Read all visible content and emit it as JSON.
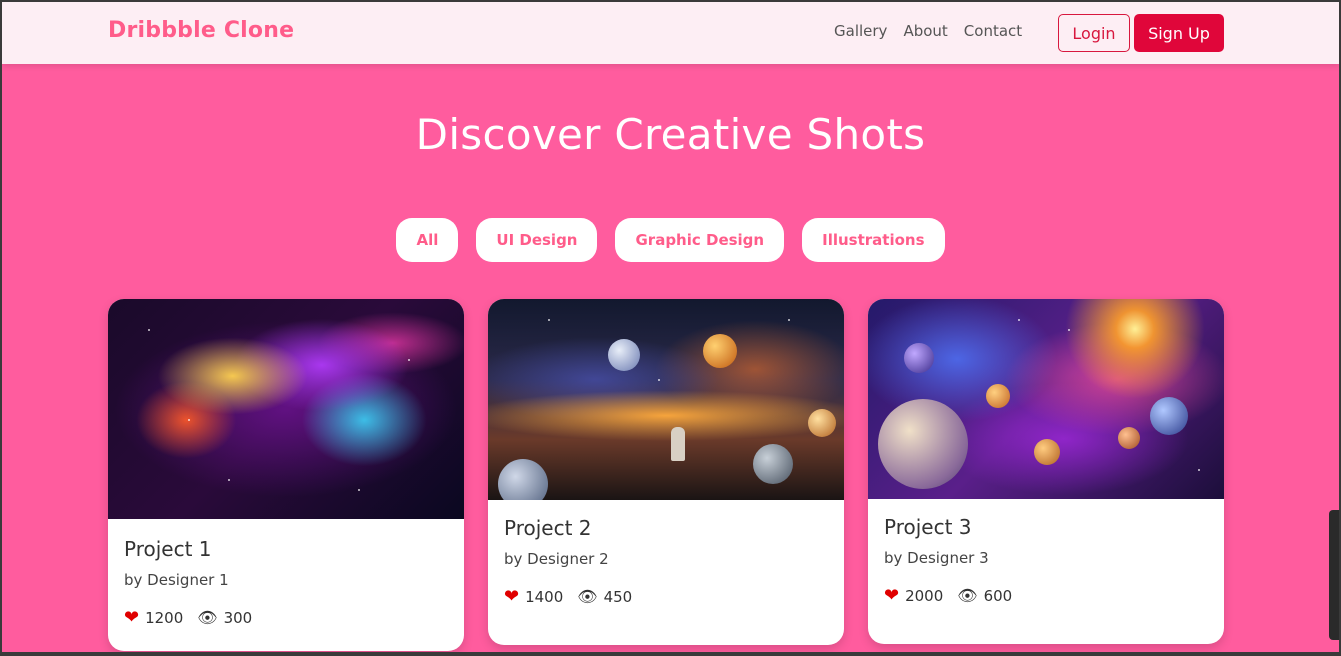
{
  "navbar": {
    "brand": "Dribbble Clone",
    "links": [
      "Gallery",
      "About",
      "Contact"
    ],
    "login_label": "Login",
    "signup_label": "Sign Up"
  },
  "hero": {
    "title": "Discover Creative Shots",
    "filters": [
      "All",
      "UI Design",
      "Graphic Design",
      "Illustrations"
    ]
  },
  "cards": [
    {
      "title": "Project 1",
      "designer": "by Designer 1",
      "likes": "1200",
      "views": "300"
    },
    {
      "title": "Project 2",
      "designer": "by Designer 2",
      "likes": "1400",
      "views": "450"
    },
    {
      "title": "Project 3",
      "designer": "by Designer 3",
      "likes": "2000",
      "views": "600"
    }
  ],
  "icons": {
    "like": "heart-icon",
    "views": "eye-icon"
  },
  "colors": {
    "page_background": "#ff5c9e",
    "navbar_background": "#fdeef4",
    "brand": "#ff5c8a",
    "signup_button": "#e0063a",
    "heart": "#e00000"
  }
}
